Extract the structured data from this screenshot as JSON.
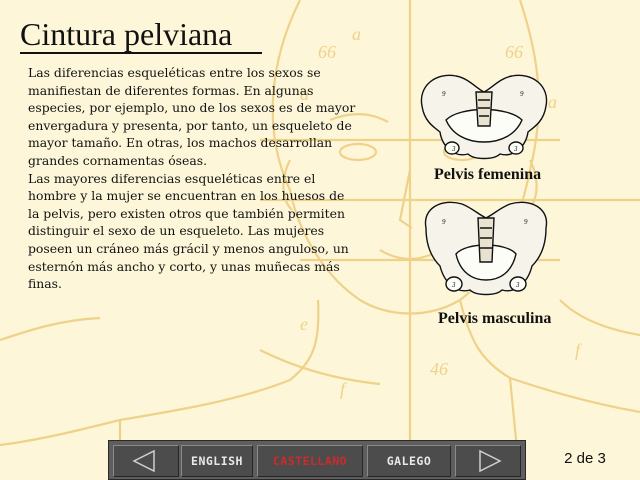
{
  "title": "Cintura pelviana",
  "paragraphs": [
    "Las diferencias esqueléticas entre los sexos se manifiestan de diferentes formas. En algunas especies, por ejemplo, uno de los sexos es de mayor envergadura y presenta, por tanto, un esqueleto de mayor tamaño. En otras, los machos desarrollan grandes cornamentas óseas.",
    "Las mayores diferencias esqueléticas entre el hombre y la mujer se encuentran en los huesos de la pelvis, pero existen otros que también permiten distinguir el sexo de un esqueleto. Las mujeres poseen un cráneo más grácil y menos anguloso, un esternón más ancho y corto, y unas muñecas más finas."
  ],
  "figures": {
    "female_caption": "Pelvis femenina",
    "male_caption": "Pelvis masculina"
  },
  "nav": {
    "prev_icon": "triangle-left-icon",
    "next_icon": "triangle-right-icon",
    "languages": [
      "ENGLISH",
      "CASTELLANO",
      "GALEGO"
    ],
    "active_language": "CASTELLANO",
    "active_color": "#cc2b2b"
  },
  "page": {
    "current": 2,
    "total": 3,
    "label": "2 de 3"
  },
  "colors": {
    "background": "#fdf6d8",
    "sketch": "#efd28a",
    "navbar": "#5e5e5e"
  }
}
